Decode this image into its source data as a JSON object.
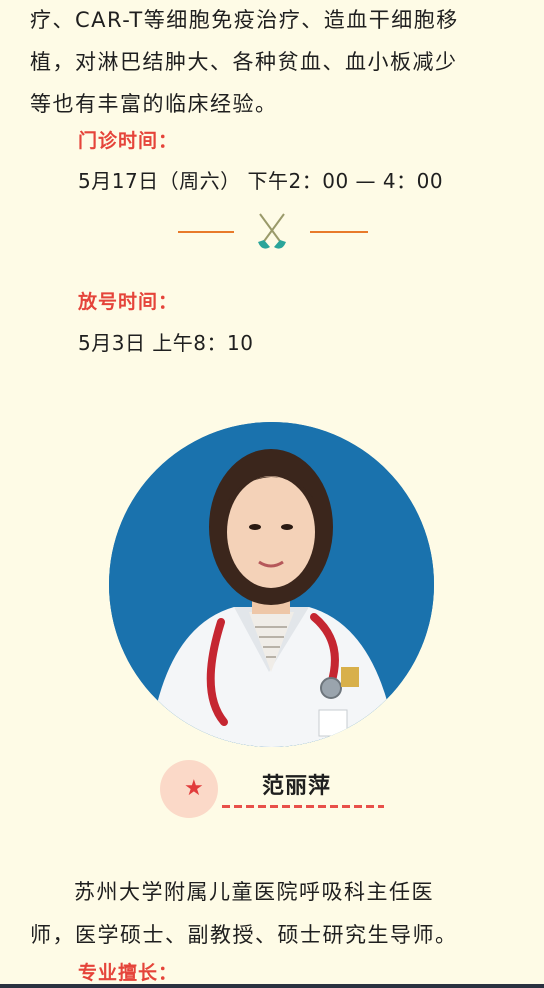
{
  "intro": {
    "lines": [
      "疗、CAR-T等细胞免疫治疗、造血干细胞移",
      "植，对淋巴结肿大、各种贫血、血小板减少",
      "等也有丰富的临床经验。"
    ]
  },
  "clinic": {
    "heading": "门诊时间：",
    "time": "5月17日（周六） 下午2：00 — 4：00"
  },
  "release": {
    "heading": "放号时间：",
    "time": "5月3日  上午8：10"
  },
  "divider": {
    "icon": "crossed-tools-icon",
    "color": "#e87a2a"
  },
  "doctor": {
    "name": "范丽萍",
    "photo": "doctor-portrait",
    "bio_lines": [
      "苏州大学附属儿童医院呼吸科主任医",
      "师，医学硕士、副教授、硕士研究生导师。"
    ],
    "specialty_heading": "专业擅长："
  },
  "colors": {
    "background": "#fefbe6",
    "accent_red": "#e5443a",
    "accent_orange": "#e87a2a",
    "photo_bg": "#1a72ad"
  }
}
